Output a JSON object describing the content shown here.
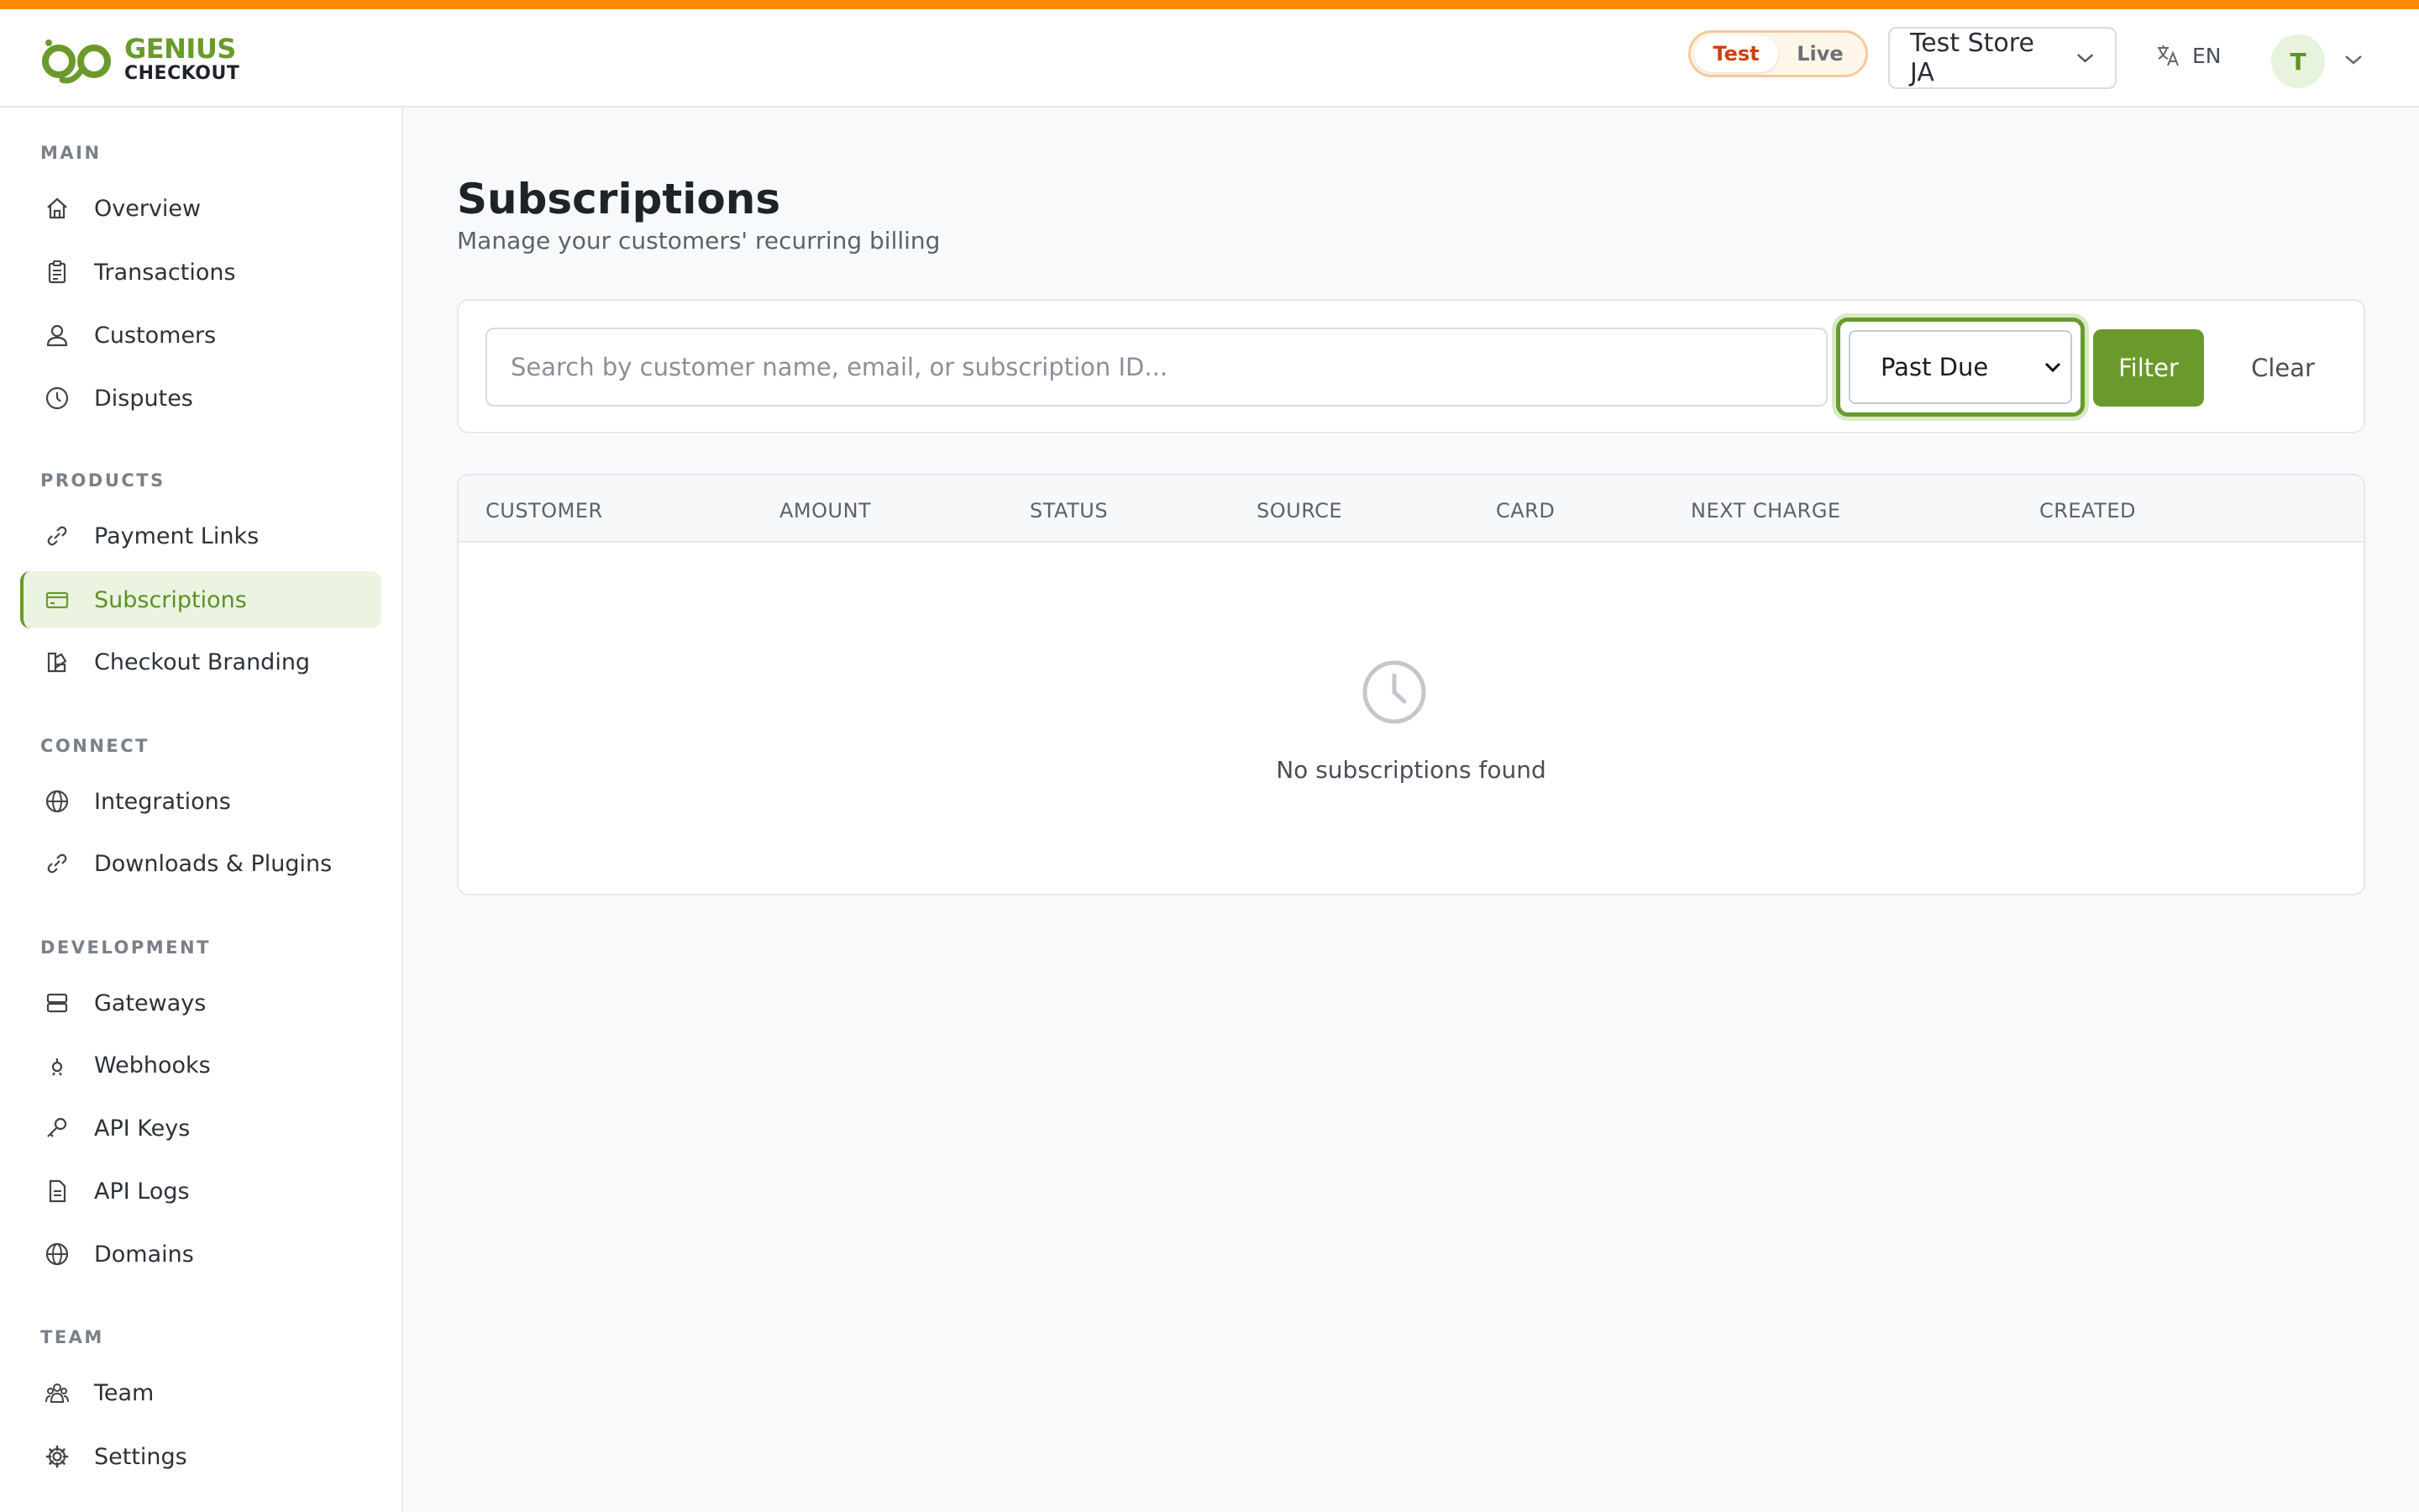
{
  "brand": {
    "line1": "GENIUS",
    "line2": "CHECKOUT"
  },
  "header": {
    "mode": {
      "test": "Test",
      "live": "Live"
    },
    "store": "Test Store JA",
    "language": "EN",
    "avatar_initial": "T"
  },
  "sidebar": {
    "main_label": "MAIN",
    "main": [
      {
        "label": "Overview",
        "icon": "home-icon"
      },
      {
        "label": "Transactions",
        "icon": "clipboard-icon"
      },
      {
        "label": "Customers",
        "icon": "users-icon"
      },
      {
        "label": "Disputes",
        "icon": "clock-icon"
      }
    ],
    "products_label": "PRODUCTS",
    "products": [
      {
        "label": "Payment Links",
        "icon": "link-icon"
      },
      {
        "label": "Subscriptions",
        "icon": "card-icon",
        "active": true
      },
      {
        "label": "Checkout Branding",
        "icon": "palette-icon"
      }
    ],
    "connect_label": "CONNECT",
    "connect": [
      {
        "label": "Integrations",
        "icon": "globe-icon"
      },
      {
        "label": "Downloads & Plugins",
        "icon": "link-icon"
      }
    ],
    "development_label": "DEVELOPMENT",
    "development": [
      {
        "label": "Gateways",
        "icon": "server-icon"
      },
      {
        "label": "Webhooks",
        "icon": "webhook-icon"
      },
      {
        "label": "API Keys",
        "icon": "key-icon"
      },
      {
        "label": "API Logs",
        "icon": "file-icon"
      },
      {
        "label": "Domains",
        "icon": "globe-icon"
      }
    ],
    "team_label": "TEAM",
    "team": [
      {
        "label": "Team",
        "icon": "team-icon"
      },
      {
        "label": "Settings",
        "icon": "gear-icon"
      }
    ]
  },
  "page": {
    "title": "Subscriptions",
    "subtitle": "Manage your customers' recurring billing"
  },
  "filters": {
    "search_placeholder": "Search by customer name, email, or subscription ID...",
    "status_selected": "Past Due",
    "filter_label": "Filter",
    "clear_label": "Clear"
  },
  "table": {
    "columns": [
      "CUSTOMER",
      "AMOUNT",
      "STATUS",
      "SOURCE",
      "CARD",
      "NEXT CHARGE",
      "CREATED"
    ],
    "empty_text": "No subscriptions found"
  },
  "colors": {
    "accent": "#ff8a00",
    "brand_green": "#6a9a2c",
    "test_badge": "#d0400a"
  }
}
